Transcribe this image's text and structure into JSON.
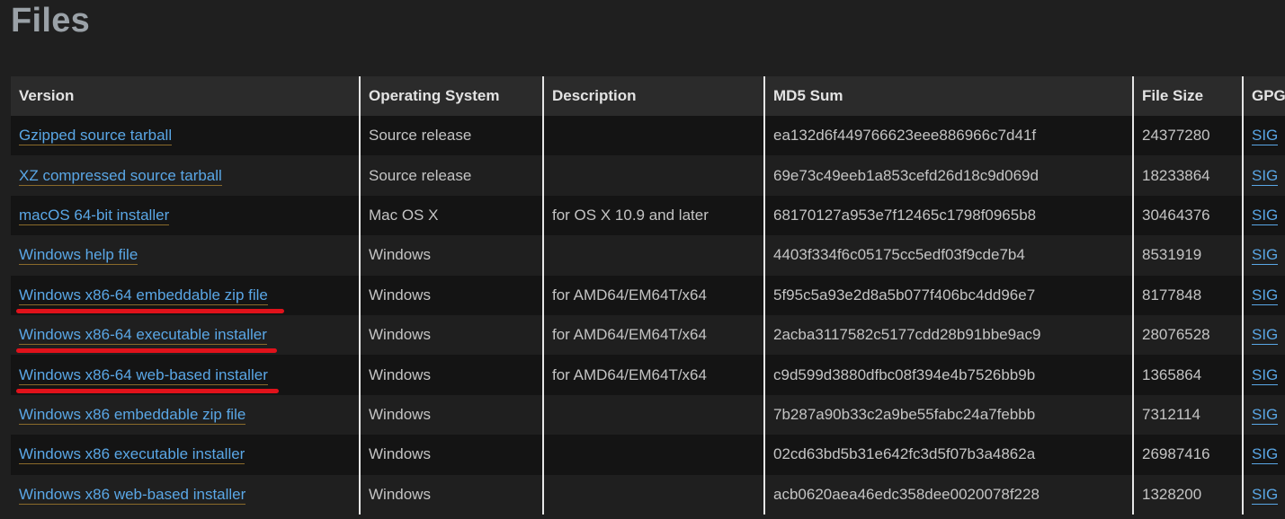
{
  "page": {
    "title": "Files"
  },
  "table": {
    "headers": {
      "version": "Version",
      "os": "Operating System",
      "description": "Description",
      "md5": "MD5 Sum",
      "size": "File Size",
      "gpg": "GPG"
    },
    "rows": [
      {
        "version": "Gzipped source tarball",
        "os": "Source release",
        "description": "",
        "md5": "ea132d6f449766623eee886966c7d41f",
        "size": "24377280",
        "gpg": "SIG"
      },
      {
        "version": "XZ compressed source tarball",
        "os": "Source release",
        "description": "",
        "md5": "69e73c49eeb1a853cefd26d18c9d069d",
        "size": "18233864",
        "gpg": "SIG"
      },
      {
        "version": "macOS 64-bit installer",
        "os": "Mac OS X",
        "description": "for OS X 10.9 and later",
        "md5": "68170127a953e7f12465c1798f0965b8",
        "size": "30464376",
        "gpg": "SIG"
      },
      {
        "version": "Windows help file",
        "os": "Windows",
        "description": "",
        "md5": "4403f334f6c05175cc5edf03f9cde7b4",
        "size": "8531919",
        "gpg": "SIG"
      },
      {
        "version": "Windows x86-64 embeddable zip file",
        "os": "Windows",
        "description": "for AMD64/EM64T/x64",
        "md5": "5f95c5a93e2d8a5b077f406bc4dd96e7",
        "size": "8177848",
        "gpg": "SIG"
      },
      {
        "version": "Windows x86-64 executable installer",
        "os": "Windows",
        "description": "for AMD64/EM64T/x64",
        "md5": "2acba3117582c5177cdd28b91bbe9ac9",
        "size": "28076528",
        "gpg": "SIG"
      },
      {
        "version": "Windows x86-64 web-based installer",
        "os": "Windows",
        "description": "for AMD64/EM64T/x64",
        "md5": "c9d599d3880dfbc08f394e4b7526bb9b",
        "size": "1365864",
        "gpg": "SIG"
      },
      {
        "version": "Windows x86 embeddable zip file",
        "os": "Windows",
        "description": "",
        "md5": "7b287a90b33c2a9be55fabc24a7febbb",
        "size": "7312114",
        "gpg": "SIG"
      },
      {
        "version": "Windows x86 executable installer",
        "os": "Windows",
        "description": "",
        "md5": "02cd63bd5b31e642fc3d5f07b3a4862a",
        "size": "26987416",
        "gpg": "SIG"
      },
      {
        "version": "Windows x86 web-based installer",
        "os": "Windows",
        "description": "",
        "md5": "acb0620aea46edc358dee0020078f228",
        "size": "1328200",
        "gpg": "SIG"
      }
    ]
  },
  "annotations": {
    "highlighted_rows": [
      "Windows x86-64 embeddable zip file",
      "Windows x86-64 executable installer",
      "Windows x86-64 web-based installer"
    ],
    "highlight_color": "#e0121b"
  },
  "colors": {
    "background": "#1f1f1f",
    "row_stripe": "#141414",
    "header_bg": "#2b2b2b",
    "link": "#5aa7e6",
    "title": "#9aa1a7"
  }
}
